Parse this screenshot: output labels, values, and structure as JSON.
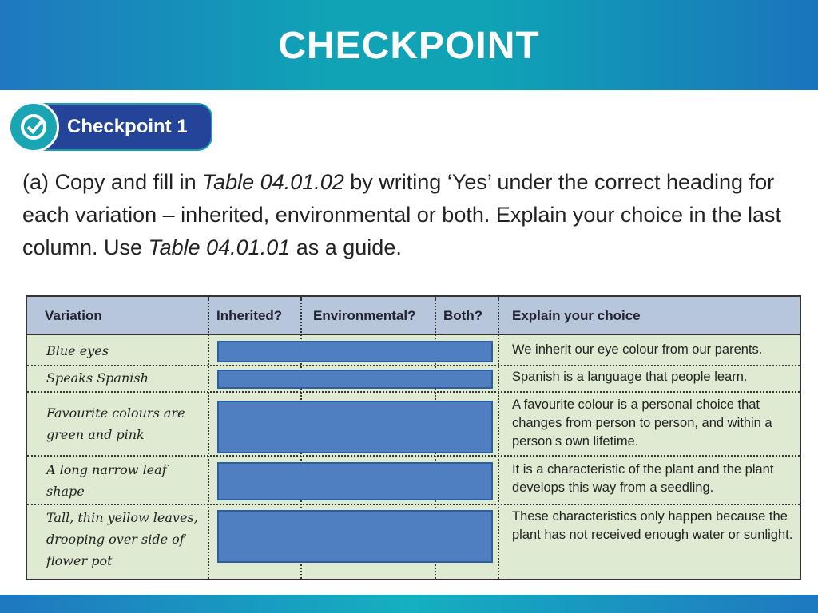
{
  "header": {
    "title": "CHECKPOINT"
  },
  "badge": {
    "label": "Checkpoint 1",
    "icon": "check-circle-icon"
  },
  "question": {
    "p1": "(a) Copy and fill in ",
    "ref1": "Table 04.01.02",
    "p2": " by writing ‘Yes’ under the correct heading for each variation – inherited, environmental or both. Explain your choice in the last column. Use ",
    "ref2": "Table 04.01.01",
    "p3": " as a guide."
  },
  "table": {
    "headers": [
      "Variation",
      "Inherited?",
      "Environmental?",
      "Both?",
      "Explain your choice"
    ],
    "rows": [
      {
        "variation": "Blue eyes",
        "explain": "We inherit our eye colour from our parents."
      },
      {
        "variation": "Speaks Spanish",
        "explain": "Spanish is a language that people learn."
      },
      {
        "variation": "Favourite colours are green and pink",
        "explain": "A favourite colour is a personal choice that changes from person to person, and within a person’s own lifetime."
      },
      {
        "variation": "A long narrow leaf shape",
        "explain": "It is a characteristic of the plant and the plant develops this way from a seedling."
      },
      {
        "variation": "Tall, thin yellow leaves, drooping over side of flower pot",
        "explain": "These characteristics only happen because the plant has not received enough water or sunlight."
      }
    ]
  },
  "colors": {
    "answer_box": "#4f7fc0",
    "header_row": "#b8c6dc",
    "body": "#dfead2",
    "badge": "#24449a"
  }
}
